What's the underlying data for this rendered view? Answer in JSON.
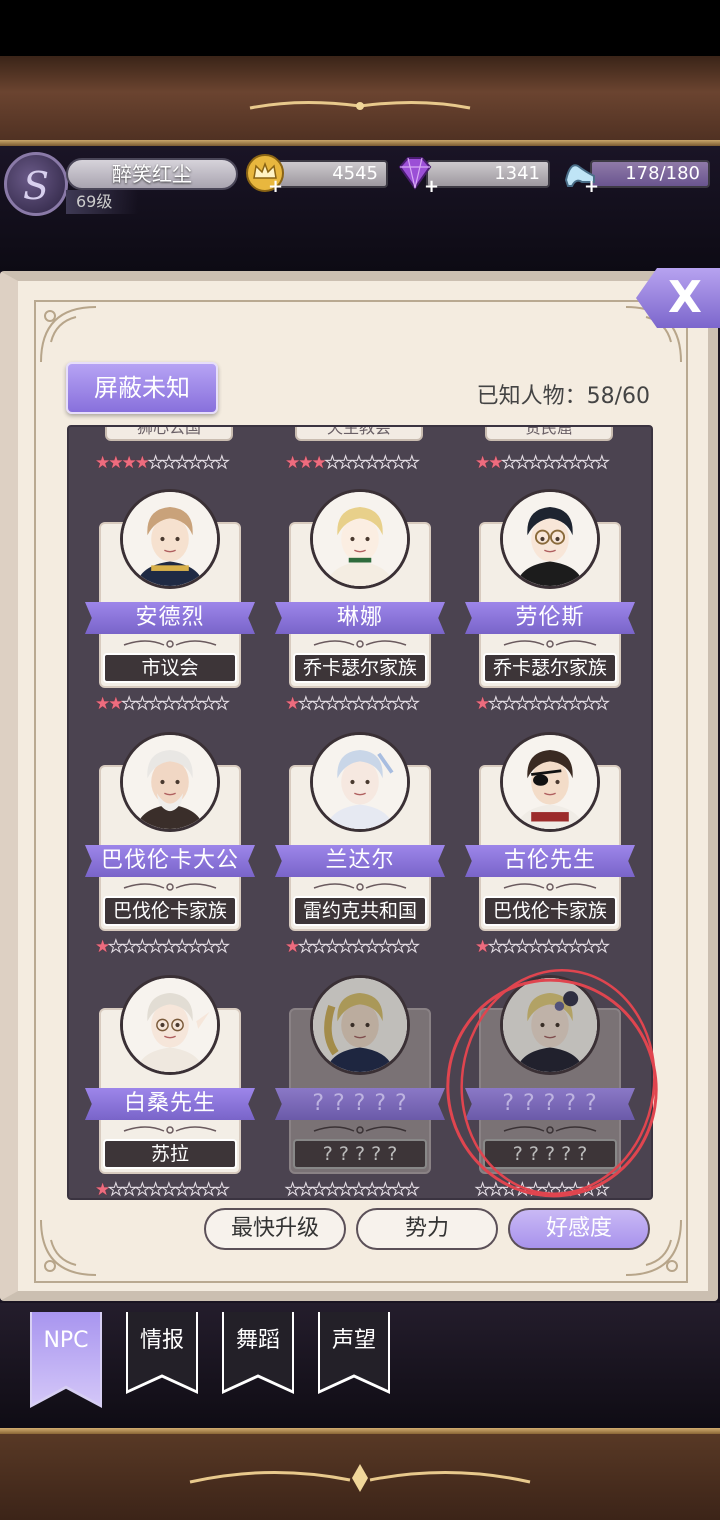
{
  "player": {
    "name": "醉笑红尘",
    "level": "69级"
  },
  "resources": [
    {
      "icon": "gold-crown-icon",
      "value": "4545"
    },
    {
      "icon": "purple-gem-icon",
      "value": "1341"
    },
    {
      "icon": "glass-slipper-icon",
      "value": "178/180"
    }
  ],
  "header": {
    "filter_label": "屏蔽未知",
    "known_count": "已知人物：58/60",
    "close_label": "X"
  },
  "prev_row": [
    {
      "faction": "狮心公国",
      "stars": 4
    },
    {
      "faction": "天主教会",
      "stars": 3
    },
    {
      "faction": "贫民窟",
      "stars": 2
    }
  ],
  "characters": [
    {
      "name": "安德烈",
      "faction": "市议会",
      "stars": 2,
      "locked": false,
      "portrait": "man-military-icon"
    },
    {
      "name": "琳娜",
      "faction": "乔卡瑟尔家族",
      "stars": 1,
      "locked": false,
      "portrait": "blonde-lady-icon"
    },
    {
      "name": "劳伦斯",
      "faction": "乔卡瑟尔家族",
      "stars": 1,
      "locked": false,
      "portrait": "glasses-butler-icon"
    },
    {
      "name": "巴伐伦卡大公",
      "faction": "巴伐伦卡家族",
      "stars": 1,
      "locked": false,
      "portrait": "white-haired-duke-icon"
    },
    {
      "name": "兰达尔",
      "faction": "雷约克共和国",
      "stars": 1,
      "locked": false,
      "portrait": "silver-haired-man-icon"
    },
    {
      "name": "古伦先生",
      "faction": "巴伐伦卡家族",
      "stars": 1,
      "locked": false,
      "portrait": "eyepatch-man-icon"
    },
    {
      "name": "白桑先生",
      "faction": "苏拉",
      "stars": 1,
      "locked": false,
      "portrait": "elf-scholar-icon"
    },
    {
      "name": "? ? ? ? ?",
      "faction": "? ? ? ? ?",
      "stars": 0,
      "locked": true,
      "portrait": "blonde-prince-icon"
    },
    {
      "name": "? ? ? ? ?",
      "faction": "? ? ? ? ?",
      "stars": 0,
      "locked": true,
      "portrait": "blonde-princess-icon"
    }
  ],
  "sort_buttons": [
    {
      "label": "最快升级",
      "active": false
    },
    {
      "label": "势力",
      "active": false
    },
    {
      "label": "好感度",
      "active": true
    }
  ],
  "tabs": [
    {
      "label": "NPC",
      "active": true
    },
    {
      "label": "情报",
      "active": false
    },
    {
      "label": "舞蹈",
      "active": false
    },
    {
      "label": "声望",
      "active": false
    }
  ],
  "colors": {
    "accent": "#9d86ea",
    "star": "#ee6c7e",
    "annotation": "#e0454f"
  }
}
